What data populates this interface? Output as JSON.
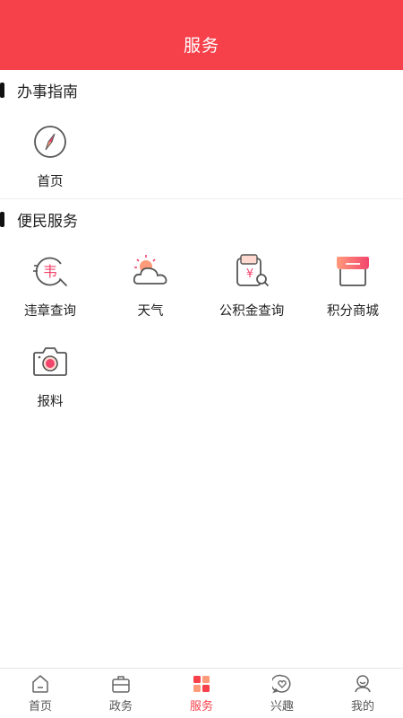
{
  "header": {
    "title": "服务"
  },
  "sections": [
    {
      "title": "办事指南",
      "items": [
        {
          "label": "首页",
          "icon": "compass-icon"
        }
      ]
    },
    {
      "title": "便民服务",
      "items": [
        {
          "label": "违章查询",
          "icon": "violation-search-icon"
        },
        {
          "label": "天气",
          "icon": "weather-icon"
        },
        {
          "label": "公积金查询",
          "icon": "fund-wallet-icon"
        },
        {
          "label": "积分商城",
          "icon": "store-icon"
        },
        {
          "label": "报料",
          "icon": "camera-icon"
        }
      ]
    }
  ],
  "tabbar": {
    "active": "服务",
    "items": [
      {
        "label": "首页",
        "icon": "home-icon"
      },
      {
        "label": "政务",
        "icon": "briefcase-icon"
      },
      {
        "label": "服务",
        "icon": "grid-icon"
      },
      {
        "label": "兴趣",
        "icon": "heart-bubble-icon"
      },
      {
        "label": "我的",
        "icon": "user-icon"
      }
    ]
  },
  "colors": {
    "brand": "#f6404a",
    "accent_gradient": [
      "#ff9a7a",
      "#f2456d"
    ]
  }
}
